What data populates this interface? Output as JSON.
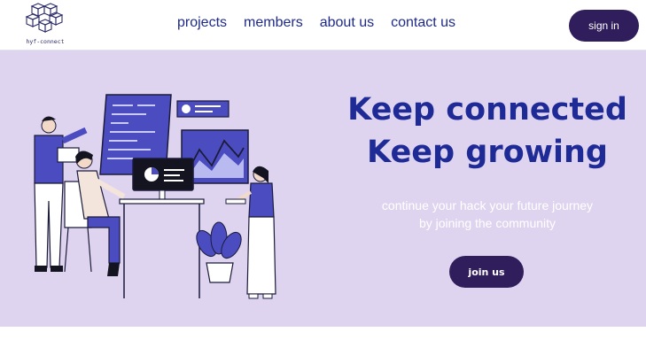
{
  "header": {
    "logo_text": "hyf-connect",
    "nav": [
      {
        "label": "projects"
      },
      {
        "label": "members"
      },
      {
        "label": "about us"
      },
      {
        "label": "contact us"
      }
    ],
    "signin_label": "sign in"
  },
  "hero": {
    "headline_line1": "Keep connected",
    "headline_line2": "Keep growing",
    "sub_line1": "continue your hack your future journey",
    "sub_line2": "by joining the community",
    "cta_label": "join us"
  },
  "colors": {
    "hero_background": "#dfd4ef",
    "accent_dark": "#301d5c",
    "headline": "#1e2a96",
    "nav_text": "#1e2a8a"
  }
}
